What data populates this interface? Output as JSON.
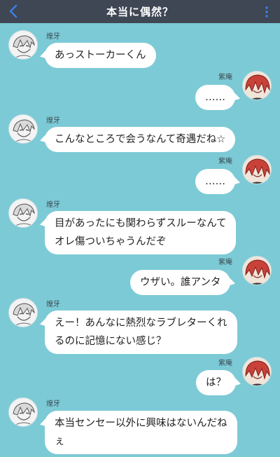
{
  "header": {
    "title": "本当に偶然？"
  },
  "characters": {
    "left_name": "煌牙",
    "right_name": "紫庵"
  },
  "messages": [
    {
      "speaker": "煌牙",
      "side": "left",
      "text": "あっストーカーくん"
    },
    {
      "speaker": "紫庵",
      "side": "right",
      "text": "……"
    },
    {
      "speaker": "煌牙",
      "side": "left",
      "text": "こんなところで会うなんて奇遇だね☆"
    },
    {
      "speaker": "紫庵",
      "side": "right",
      "text": "……"
    },
    {
      "speaker": "煌牙",
      "side": "left",
      "text": "目があったにも関わらずスルーなんて\nオレ傷ついちゃうんだぞ"
    },
    {
      "speaker": "紫庵",
      "side": "right",
      "text": "ウザい。誰アンタ"
    },
    {
      "speaker": "煌牙",
      "side": "left",
      "text": "えー！あんなに熱烈なラブレターくれ\nるのに記憶にない感じ？"
    },
    {
      "speaker": "紫庵",
      "side": "right",
      "text": "は？"
    },
    {
      "speaker": "煌牙",
      "side": "left",
      "text": "本当センセー以外に興味はないんだね\nぇ"
    }
  ],
  "colors": {
    "background": "#7ccad6",
    "header": "#3f4654",
    "accent": "#3a7ee0"
  }
}
